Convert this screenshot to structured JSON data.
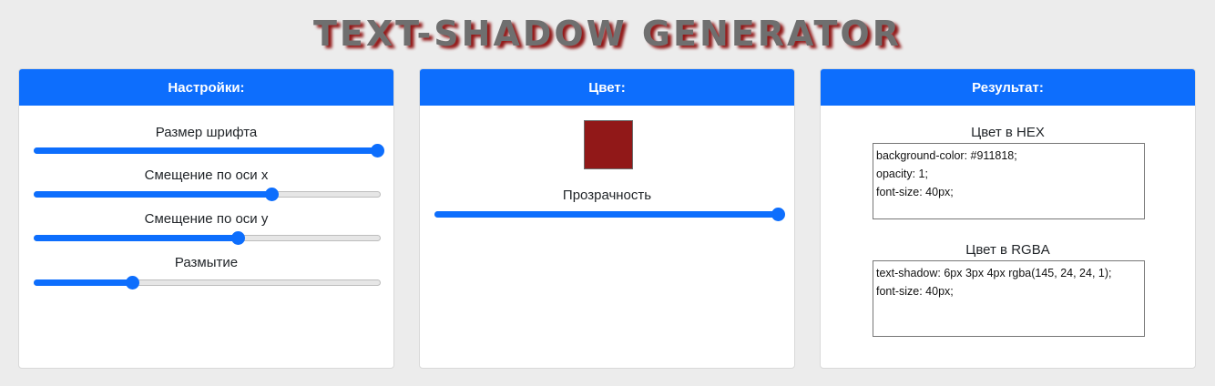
{
  "title": "TEXT-SHADOW GENERATOR",
  "colors": {
    "accent": "#0d6efd",
    "shadow_color": "#911818",
    "background": "#ececec"
  },
  "settings": {
    "header": "Настройки:",
    "sliders": [
      {
        "label": "Размер шрифта",
        "value_fraction": 1.0
      },
      {
        "label": "Смещение по оси x",
        "value_fraction": 0.69
      },
      {
        "label": "Смещение по оси y",
        "value_fraction": 0.59
      },
      {
        "label": "Размытие",
        "value_fraction": 0.28
      }
    ]
  },
  "color_panel": {
    "header": "Цвет:",
    "swatch_color": "#911818",
    "opacity_label": "Прозрачность",
    "opacity_fraction": 1.0
  },
  "result": {
    "header": "Результат:",
    "hex_label": "Цвет в HEX",
    "hex_lines": [
      "background-color: #911818;",
      "opacity: 1;",
      "font-size: 40px;"
    ],
    "rgba_label": "Цвет в RGBA",
    "rgba_lines": [
      "text-shadow: 6px 3px 4px rgba(145, 24, 24, 1);",
      "font-size: 40px;"
    ]
  }
}
